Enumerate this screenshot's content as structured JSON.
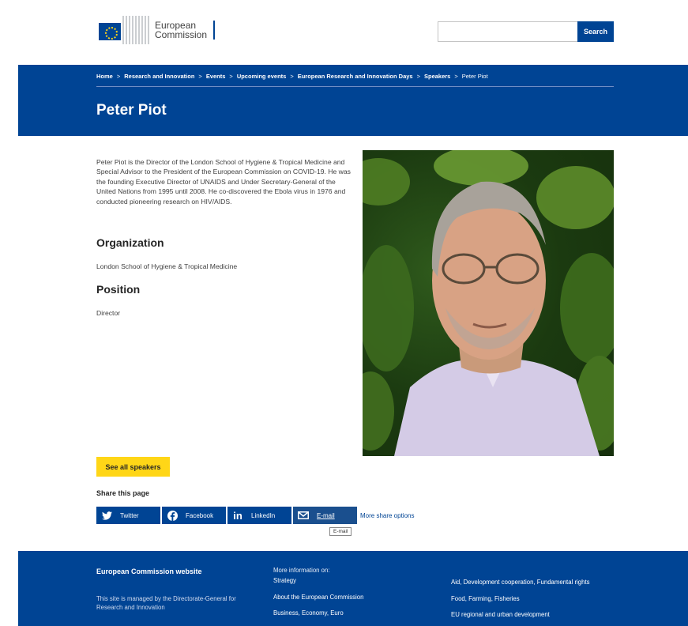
{
  "header": {
    "logo_line1": "European",
    "logo_line2": "Commission",
    "search_placeholder": "",
    "search_button": "Search"
  },
  "breadcrumb": [
    "Home",
    "Research and Innovation",
    "Events",
    "Upcoming events",
    "European Research and Innovation Days",
    "Speakers",
    "Peter Piot"
  ],
  "page_title": "Peter Piot",
  "bio": "Peter Piot is the Director of the London School of Hygiene & Tropical Medicine and Special Advisor to the President of the European Commission on COVID-19. He was the founding Executive Director of UNAIDS and Under Secretary-General of the United Nations from 1995 until 2008. He co-discovered the Ebola virus in 1976 and conducted pioneering research on HIV/AIDS.",
  "organization": {
    "heading": "Organization",
    "value": "London School of Hygiene & Tropical Medicine"
  },
  "position": {
    "heading": "Position",
    "value": "Director"
  },
  "see_all_button": "See all speakers",
  "share": {
    "title": "Share this page",
    "buttons": [
      {
        "label": "Twitter",
        "icon": "twitter-icon"
      },
      {
        "label": "Facebook",
        "icon": "facebook-icon"
      },
      {
        "label": "LinkedIn",
        "icon": "linkedin-icon"
      },
      {
        "label": "E-mail",
        "icon": "email-icon"
      }
    ],
    "more": "More share options",
    "tooltip": "E-mail"
  },
  "footer": {
    "title": "European Commission website",
    "managed_by": "This site is managed by the Directorate-General for Research and Innovation",
    "more_info_label": "More information on:",
    "col2_links": [
      "Strategy",
      "About the European Commission",
      "Business, Economy, Euro"
    ],
    "col3_links": [
      "Aid, Development cooperation, Fundamental rights",
      "Food, Farming, Fisheries",
      "EU regional and urban development"
    ]
  },
  "colors": {
    "brand_blue": "#004494",
    "accent_yellow": "#ffd617"
  }
}
